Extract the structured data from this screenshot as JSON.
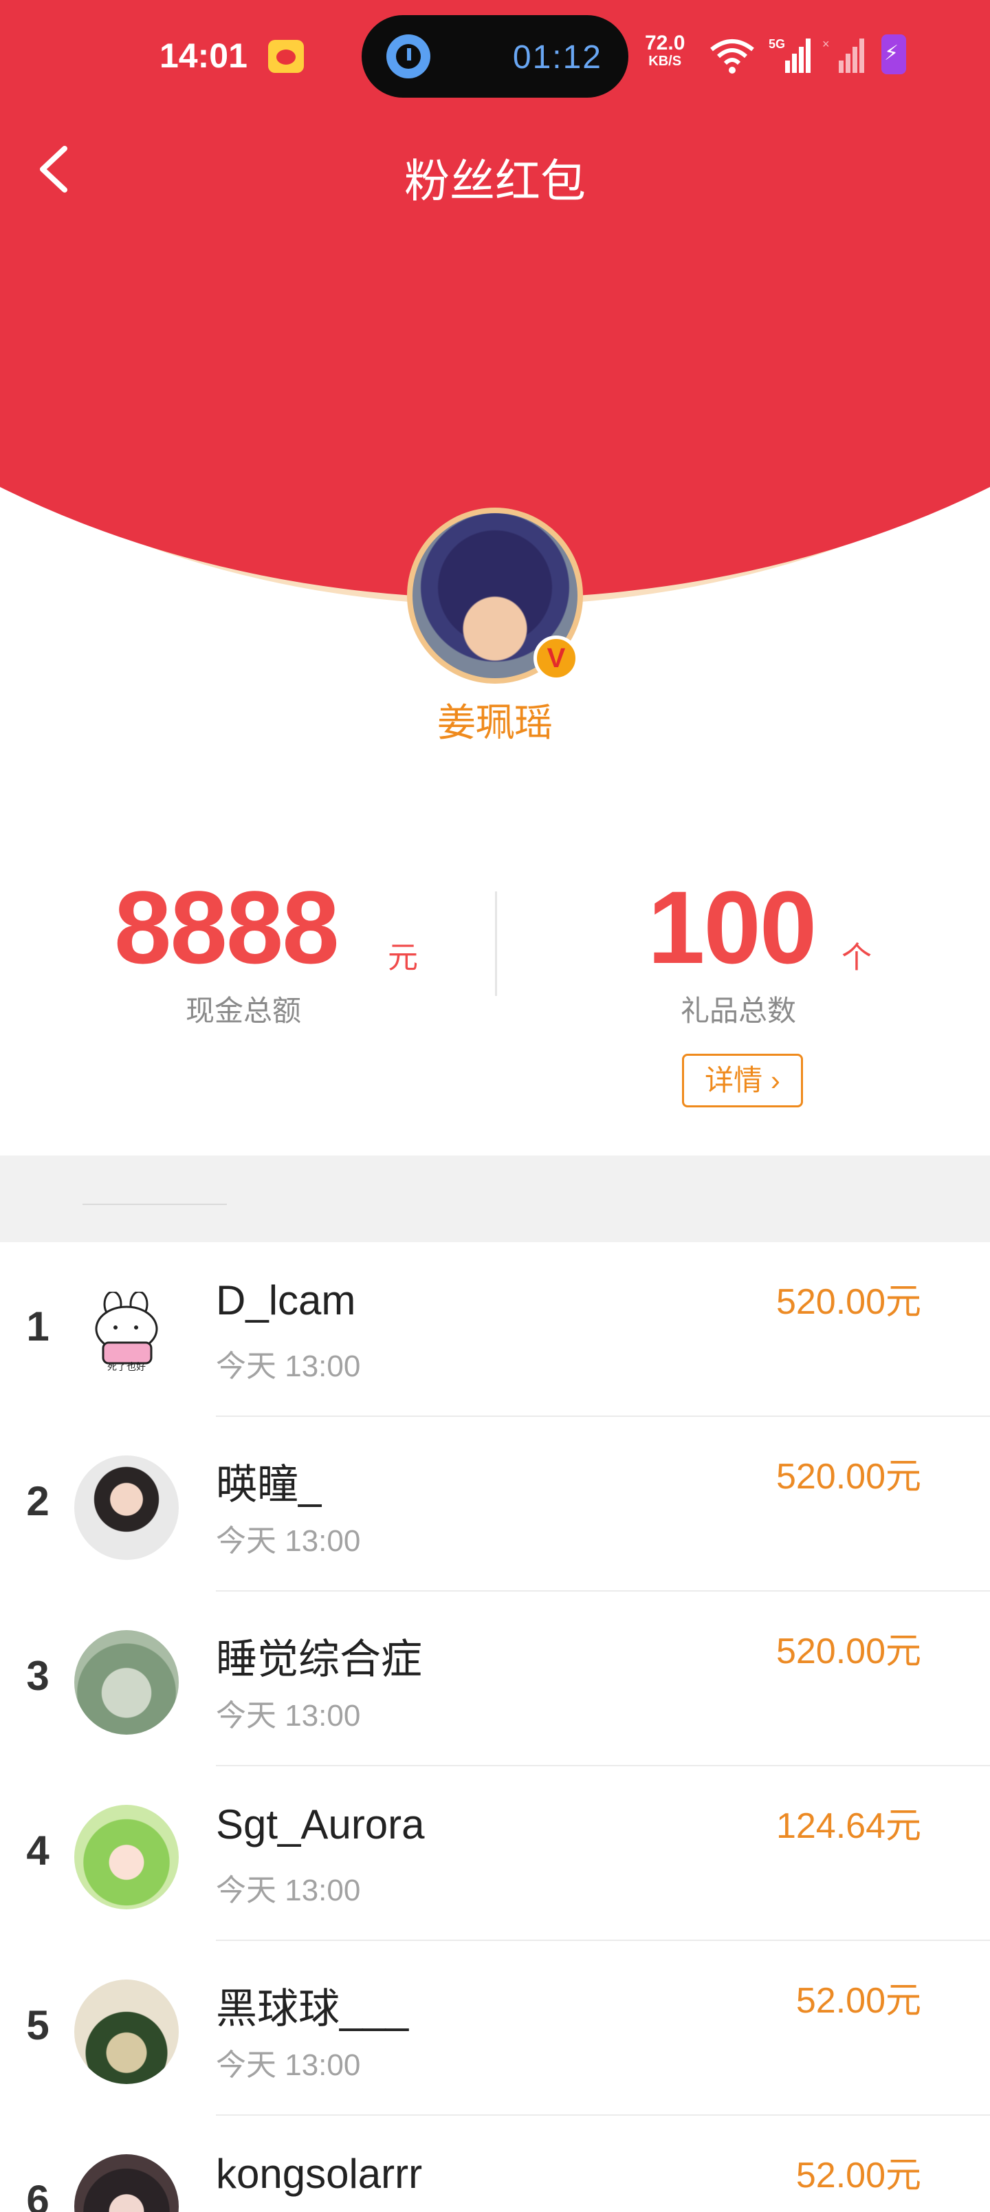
{
  "status_bar": {
    "time": "14:01",
    "island_time": "01:12",
    "net_speed": "72.0",
    "net_unit": "KB/S",
    "network": "5G",
    "icons": [
      "weibo-icon",
      "alarm-icon",
      "wifi-icon",
      "signal-icon",
      "battery-charging-icon"
    ]
  },
  "header": {
    "title": "粉丝红包",
    "back_icon": "chevron-left-icon",
    "accent_color": "#e83443"
  },
  "profile": {
    "name": "姜珮瑶",
    "badge": "V"
  },
  "stats": {
    "cash": {
      "value": "8888",
      "unit": "元",
      "label": "现金总额"
    },
    "gifts": {
      "value": "100",
      "unit": "个",
      "label": "礼品总数"
    },
    "detail_button": "详情"
  },
  "list": [
    {
      "rank": "1",
      "name": "D_lcam",
      "time": "今天 13:00",
      "amount": "520.00元",
      "avatar_text": "死了也好"
    },
    {
      "rank": "2",
      "name": "暎瞳_",
      "time": "今天 13:00",
      "amount": "520.00元"
    },
    {
      "rank": "3",
      "name": "睡觉综合症",
      "time": "今天 13:00",
      "amount": "520.00元"
    },
    {
      "rank": "4",
      "name": "Sgt_Aurora",
      "time": "今天 13:00",
      "amount": "124.64元"
    },
    {
      "rank": "5",
      "name": "黑球球___",
      "time": "今天 13:00",
      "amount": "52.00元"
    },
    {
      "rank": "6",
      "name": "kongsolarrr",
      "time": "",
      "amount": "52.00元"
    }
  ]
}
